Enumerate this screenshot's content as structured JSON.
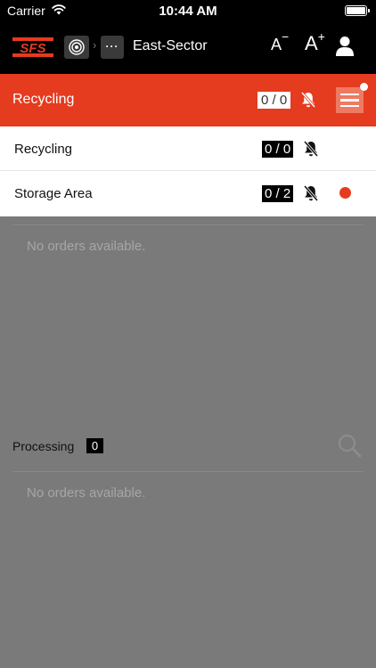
{
  "status_bar": {
    "carrier": "Carrier",
    "time": "10:44 AM"
  },
  "app_bar": {
    "logo_text": "SFS",
    "more_label": "···",
    "sector_title": "East-Sector",
    "font_smaller_label": "A",
    "font_smaller_mod": "−",
    "font_larger_label": "A",
    "font_larger_mod": "+"
  },
  "current_station": {
    "title": "Recycling",
    "counter": "0 / 0"
  },
  "station_list": [
    {
      "label": "Recycling",
      "counter": "0 / 0",
      "has_alert": false
    },
    {
      "label": "Storage Area",
      "counter": "0 / 2",
      "has_alert": true
    }
  ],
  "orders_top": {
    "empty_text": "No orders available."
  },
  "processing": {
    "label": "Processing",
    "count": "0",
    "empty_text": "No orders available."
  },
  "colors": {
    "brand_red": "#e53b1f",
    "overlay_gray": "#7a7a7a",
    "app_bar_black": "#000000"
  },
  "icons": [
    "wifi-icon",
    "battery-icon",
    "target-icon",
    "chevron-right-icon",
    "more-icon",
    "user-icon",
    "bell-off-icon",
    "menu-icon",
    "search-icon"
  ]
}
